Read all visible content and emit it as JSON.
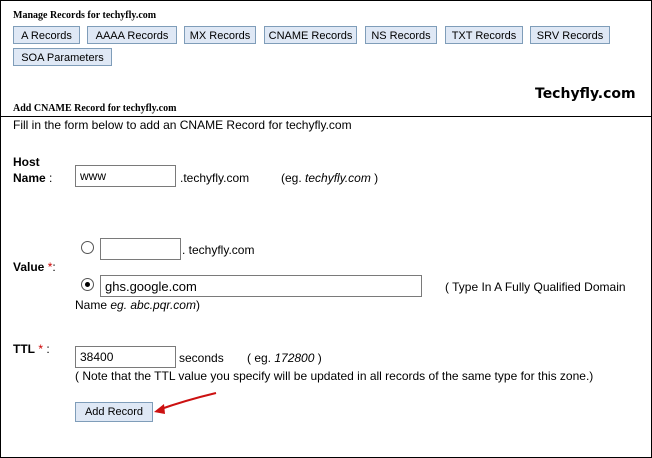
{
  "header": {
    "title": "Manage Records for techyfly.com"
  },
  "tabs": [
    {
      "label": "A Records"
    },
    {
      "label": "AAAA Records"
    },
    {
      "label": "MX Records"
    },
    {
      "label": "CNAME Records"
    },
    {
      "label": "NS Records"
    },
    {
      "label": "TXT Records"
    },
    {
      "label": "SRV Records"
    },
    {
      "label": "SOA Parameters"
    }
  ],
  "section": {
    "title": "Add CNAME Record for techyfly.com",
    "brand": "Techyfly.com",
    "intro": "Fill in the form below to add an CNAME Record for techyfly.com"
  },
  "host": {
    "label_line1": "Host",
    "label_line2": "Name",
    "colon": ":",
    "value": "www",
    "suffix": ".techyfly.com",
    "example_prefix": "(eg.",
    "example": "techyfly.com",
    "example_suffix": ")"
  },
  "value_field": {
    "label": "Value",
    "required_mark": "*",
    "colon": ":",
    "option1_value": "",
    "option1_suffix": ". techyfly.com",
    "option2_value": "ghs.google.com",
    "option2_selected": true,
    "hint_line1": "( Type In A Fully Qualified Domain",
    "hint_line2_prefix": "Name",
    "hint_line2_example": "eg. abc.pqr.com",
    "hint_line2_suffix": ")"
  },
  "ttl": {
    "label": "TTL",
    "required_mark": "*",
    "colon": ":",
    "value": "38400",
    "unit": "seconds",
    "example_prefix": "( eg.",
    "example": "172800",
    "example_suffix": ")",
    "note": "( Note that the TTL value you specify will be updated in all records of the same type for this zone.)"
  },
  "submit": {
    "label": "Add Record"
  },
  "colors": {
    "tab_bg": "#dfe8f5",
    "tab_border": "#7f9db9",
    "required": "#cc0000",
    "arrow": "#cc1111"
  },
  "icons": {
    "annotation": "red-arrow-icon"
  }
}
